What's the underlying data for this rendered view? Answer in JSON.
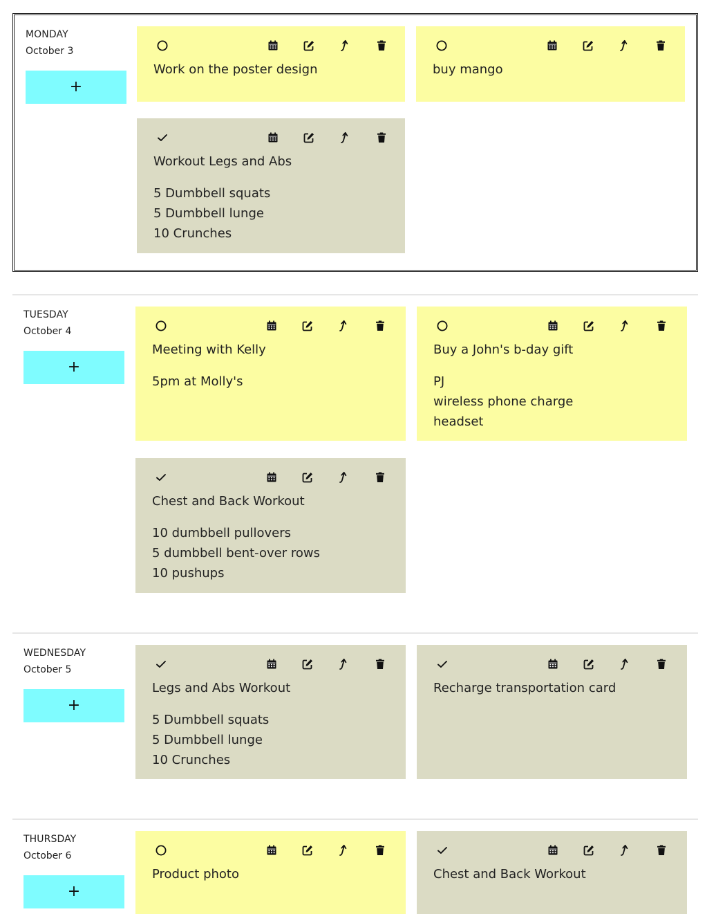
{
  "add_label": "+",
  "colors": {
    "todo_card": "#fcfda2",
    "done_card": "#dbdbc4",
    "add_button": "#7ffcff"
  },
  "icons": {
    "status_todo": "circle-icon",
    "status_done": "check-icon",
    "tools": [
      "calendar-icon",
      "edit-icon",
      "move-up-icon",
      "trash-icon"
    ]
  },
  "days": [
    {
      "weekday": "MONDAY",
      "date": "October 3",
      "selected": true,
      "notes": [
        {
          "status": "todo",
          "title": "Work on the poster design",
          "lines": []
        },
        {
          "status": "todo",
          "title": "buy mango",
          "lines": []
        },
        {
          "status": "done",
          "title": "Workout Legs and Abs",
          "lines": [
            "5 Dumbbell squats",
            "5 Dumbbell lunge",
            "10 Crunches"
          ]
        }
      ]
    },
    {
      "weekday": "TUESDAY",
      "date": "October 4",
      "selected": false,
      "notes": [
        {
          "status": "todo",
          "title": "Meeting with Kelly",
          "lines": [
            "5pm at Molly's"
          ]
        },
        {
          "status": "todo",
          "title": "Buy a John's b-day gift",
          "lines": [
            "PJ",
            "wireless phone charge",
            "headset"
          ]
        },
        {
          "status": "done",
          "title": "Chest and Back Workout",
          "lines": [
            "10 dumbbell pullovers",
            "5 dumbbell bent-over rows",
            "10 pushups"
          ]
        }
      ]
    },
    {
      "weekday": "WEDNESDAY",
      "date": "October 5",
      "selected": false,
      "notes": [
        {
          "status": "done",
          "title": "Legs and Abs Workout",
          "lines": [
            "5 Dumbbell squats",
            "5 Dumbbell lunge",
            "10 Crunches"
          ]
        },
        {
          "status": "done",
          "title": "Recharge transportation card",
          "lines": []
        }
      ]
    },
    {
      "weekday": "THURSDAY",
      "date": "October 6",
      "selected": false,
      "notes": [
        {
          "status": "todo",
          "title": "Product photo",
          "lines": []
        },
        {
          "status": "done",
          "title": "Chest and Back Workout",
          "lines": []
        }
      ]
    }
  ]
}
